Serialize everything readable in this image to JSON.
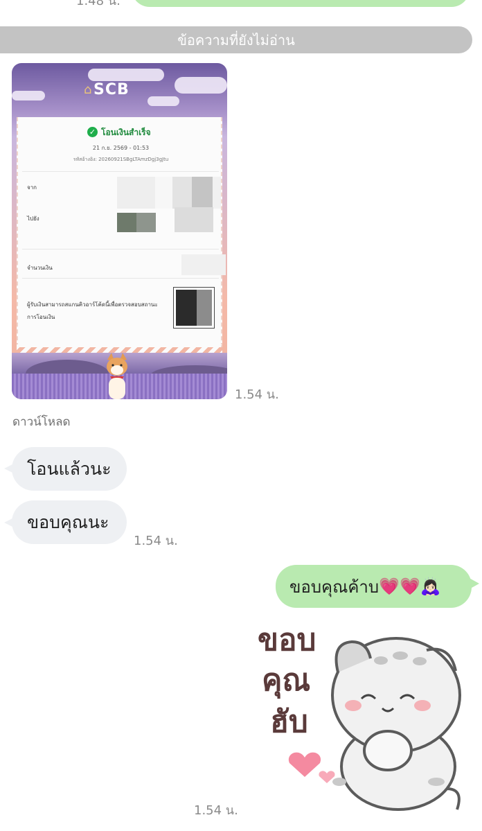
{
  "previous": {
    "time": "1.48 น."
  },
  "unread_divider": "ข้อความที่ยังไม่อ่าน",
  "receipt": {
    "bank": "SCB",
    "status": "โอนเงินสำเร็จ",
    "datetime": "21 ก.ย. 2569 - 01:53",
    "reference": "รหัสอ้างอิง: 20260921SBgLTAmzDgj3gJtu",
    "label_from": "จาก",
    "label_to": "ไปยัง",
    "label_amount": "จำนวนเงิน",
    "qr_note": "ผู้รับเงินสามารถสแกนคิวอาร์โค้ดนี้เพื่อตรวจสอบสถานะการโอนเงิน",
    "time": "1.54 น.",
    "download": "ดาวน์โหลด"
  },
  "messages": [
    {
      "side": "incoming",
      "text": "โอนแล้วนะ",
      "time": ""
    },
    {
      "side": "incoming",
      "text": "ขอบคุณนะ",
      "time": "1.54 น."
    },
    {
      "side": "outgoing",
      "text": "ขอบคุณค้าบ",
      "emoji": "💗💗🙇🏻‍♀️"
    }
  ],
  "sticker": {
    "text_lines": [
      "ขอบ",
      "คุณ",
      "ฮับ"
    ],
    "icon": "grey-cat-bowing-sticker",
    "time": "1.54 น."
  },
  "colors": {
    "outgoing_bubble": "#b9eab0",
    "incoming_bubble": "#eef0f3",
    "divider": "#c3c3c3",
    "timestamp": "#8a8a8a"
  }
}
